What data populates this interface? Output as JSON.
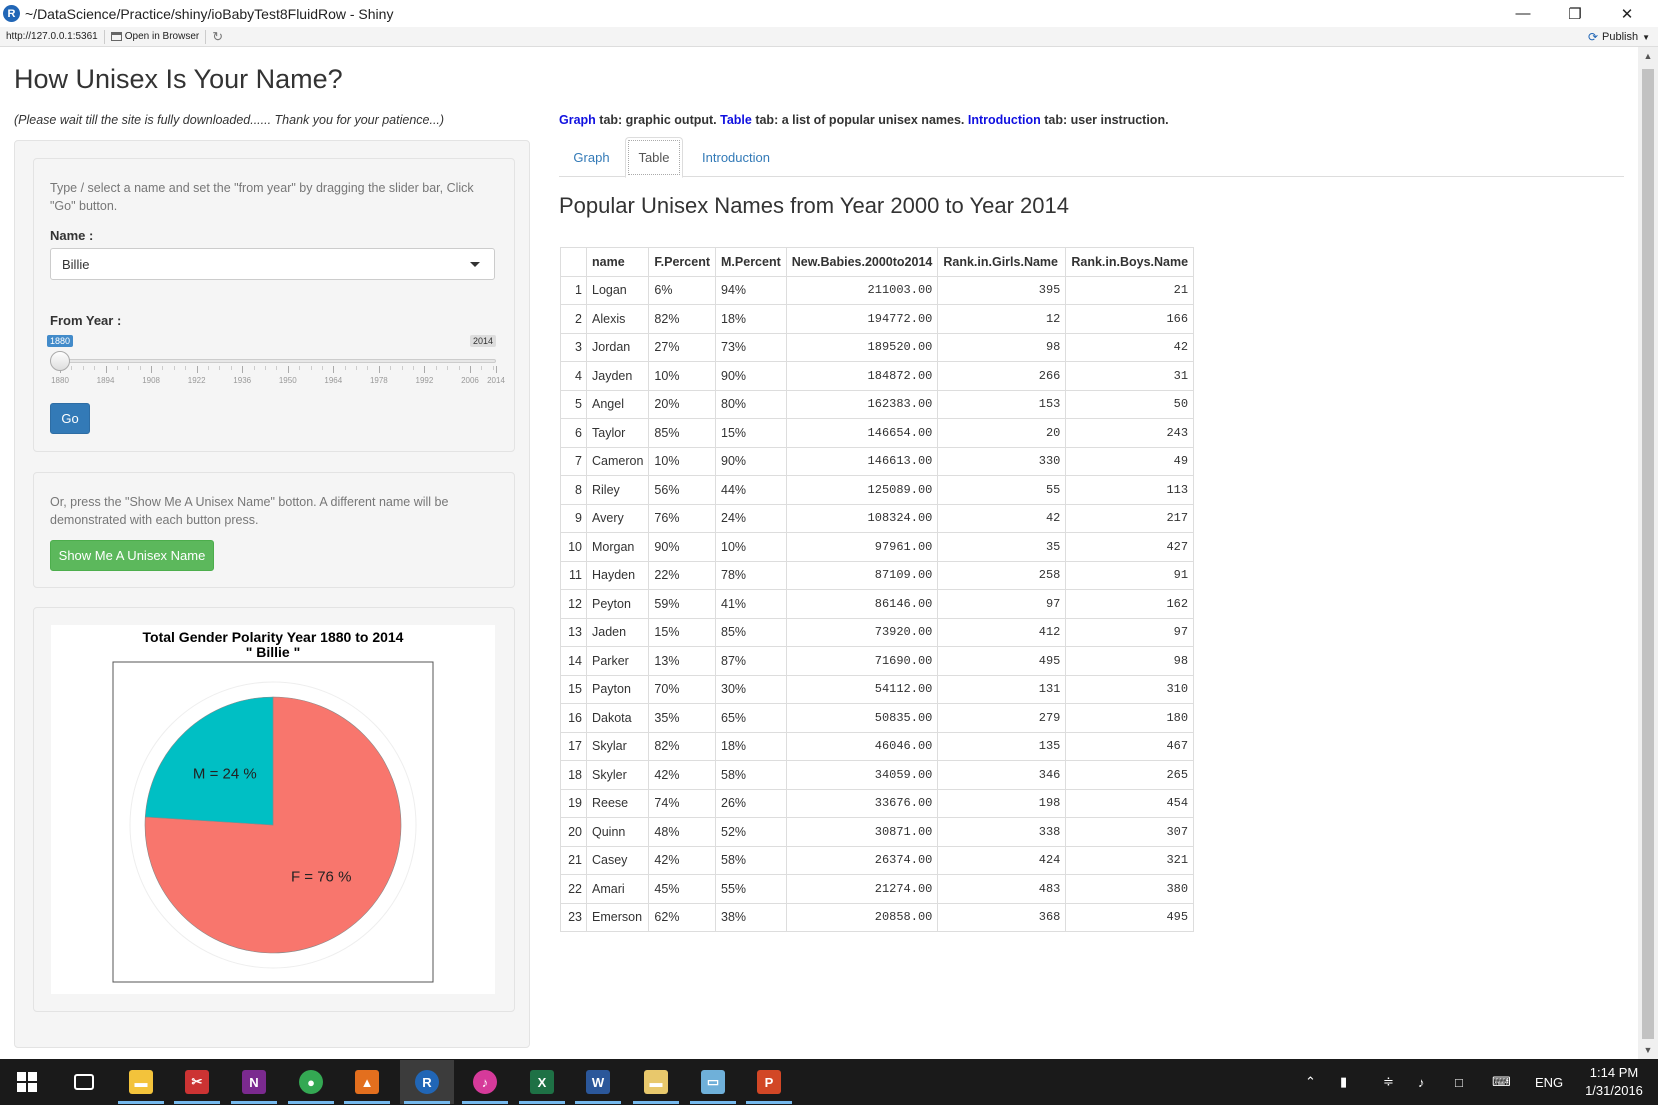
{
  "window": {
    "title": "~/DataScience/Practice/shiny/ioBabyTest8FluidRow - Shiny",
    "url": "http://127.0.0.1:5361",
    "open_in_browser": "Open in Browser",
    "publish": "Publish"
  },
  "app": {
    "title": "How Unisex Is Your Name?",
    "wait_note": "(Please wait till the site is fully downloaded...... Thank you for your patience...)"
  },
  "sidebar": {
    "help1": "Type / select a name and set the \"from year\" by dragging the slider bar, Click \"Go\" button.",
    "name_label": "Name :",
    "name_value": "Billie",
    "from_year_label": "From Year :",
    "slider": {
      "min": 1880,
      "max": 2014,
      "value": 1880,
      "min_label": "1880",
      "max_label": "2014",
      "ticks": [
        "1880",
        "1894",
        "1908",
        "1922",
        "1936",
        "1950",
        "1964",
        "1978",
        "1992",
        "2006",
        "2014"
      ]
    },
    "go_label": "Go",
    "help2": "Or, press the \"Show Me A Unisex Name\" botton. A different name will be demonstrated with each button press.",
    "show_label": "Show Me A Unisex Name"
  },
  "chart_data": {
    "type": "pie",
    "title": "Total Gender Polarity Year 1880 to 2014",
    "subtitle": "\" Billie \"",
    "slices": [
      {
        "label": "F = 76 %",
        "value": 76,
        "color": "#f8766d"
      },
      {
        "label": "M = 24 %",
        "value": 24,
        "color": "#00bfc4"
      }
    ]
  },
  "main": {
    "desc": {
      "graph": "Graph",
      "graph_text": " tab: graphic output. ",
      "table": "Table",
      "table_text": " tab: a list of popular unisex names. ",
      "intro": "Introduction",
      "intro_text": " tab: user instruction."
    },
    "tabs": [
      {
        "label": "Graph"
      },
      {
        "label": "Table"
      },
      {
        "label": "Introduction"
      }
    ],
    "table_title": "Popular Unisex Names from Year 2000 to Year 2014",
    "columns": [
      "",
      "name",
      "F.Percent",
      "M.Percent",
      "New.Babies.2000to2014",
      "Rank.in.Girls.Name",
      "Rank.in.Boys.Name"
    ],
    "rows": [
      [
        "1",
        "Logan",
        "6%",
        "94%",
        "211003.00",
        "395",
        "21"
      ],
      [
        "2",
        "Alexis",
        "82%",
        "18%",
        "194772.00",
        "12",
        "166"
      ],
      [
        "3",
        "Jordan",
        "27%",
        "73%",
        "189520.00",
        "98",
        "42"
      ],
      [
        "4",
        "Jayden",
        "10%",
        "90%",
        "184872.00",
        "266",
        "31"
      ],
      [
        "5",
        "Angel",
        "20%",
        "80%",
        "162383.00",
        "153",
        "50"
      ],
      [
        "6",
        "Taylor",
        "85%",
        "15%",
        "146654.00",
        "20",
        "243"
      ],
      [
        "7",
        "Cameron",
        "10%",
        "90%",
        "146613.00",
        "330",
        "49"
      ],
      [
        "8",
        "Riley",
        "56%",
        "44%",
        "125089.00",
        "55",
        "113"
      ],
      [
        "9",
        "Avery",
        "76%",
        "24%",
        "108324.00",
        "42",
        "217"
      ],
      [
        "10",
        "Morgan",
        "90%",
        "10%",
        "97961.00",
        "35",
        "427"
      ],
      [
        "11",
        "Hayden",
        "22%",
        "78%",
        "87109.00",
        "258",
        "91"
      ],
      [
        "12",
        "Peyton",
        "59%",
        "41%",
        "86146.00",
        "97",
        "162"
      ],
      [
        "13",
        "Jaden",
        "15%",
        "85%",
        "73920.00",
        "412",
        "97"
      ],
      [
        "14",
        "Parker",
        "13%",
        "87%",
        "71690.00",
        "495",
        "98"
      ],
      [
        "15",
        "Payton",
        "70%",
        "30%",
        "54112.00",
        "131",
        "310"
      ],
      [
        "16",
        "Dakota",
        "35%",
        "65%",
        "50835.00",
        "279",
        "180"
      ],
      [
        "17",
        "Skylar",
        "82%",
        "18%",
        "46046.00",
        "135",
        "467"
      ],
      [
        "18",
        "Skyler",
        "42%",
        "58%",
        "34059.00",
        "346",
        "265"
      ],
      [
        "19",
        "Reese",
        "74%",
        "26%",
        "33676.00",
        "198",
        "454"
      ],
      [
        "20",
        "Quinn",
        "48%",
        "52%",
        "30871.00",
        "338",
        "307"
      ],
      [
        "21",
        "Casey",
        "42%",
        "58%",
        "26374.00",
        "424",
        "321"
      ],
      [
        "22",
        "Amari",
        "45%",
        "55%",
        "21274.00",
        "483",
        "380"
      ],
      [
        "23",
        "Emerson",
        "62%",
        "38%",
        "20858.00",
        "368",
        "495"
      ]
    ]
  },
  "taskbar": {
    "apps": [
      {
        "icon": "task-view-icon",
        "color": "#1a1a1a"
      },
      {
        "icon": "file-explorer-icon",
        "color": "#f3c33b"
      },
      {
        "icon": "snipping-tool-icon",
        "color": "#cc3333"
      },
      {
        "icon": "onenote-icon",
        "color": "#7b2a8f"
      },
      {
        "icon": "chrome-icon",
        "color": "#34a853"
      },
      {
        "icon": "matlab-icon",
        "color": "#e36f1e"
      },
      {
        "icon": "rstudio-icon",
        "color": "#2166b6"
      },
      {
        "icon": "itunes-icon",
        "color": "#d63a9a"
      },
      {
        "icon": "excel-icon",
        "color": "#1e7145"
      },
      {
        "icon": "word-icon",
        "color": "#2b579a"
      },
      {
        "icon": "folder-icon",
        "color": "#e8c86c"
      },
      {
        "icon": "notepad-icon",
        "color": "#6fb0d9"
      },
      {
        "icon": "powerpoint-icon",
        "color": "#d24726"
      }
    ],
    "lang": "ENG",
    "time": "1:14 PM",
    "date": "1/31/2016"
  }
}
